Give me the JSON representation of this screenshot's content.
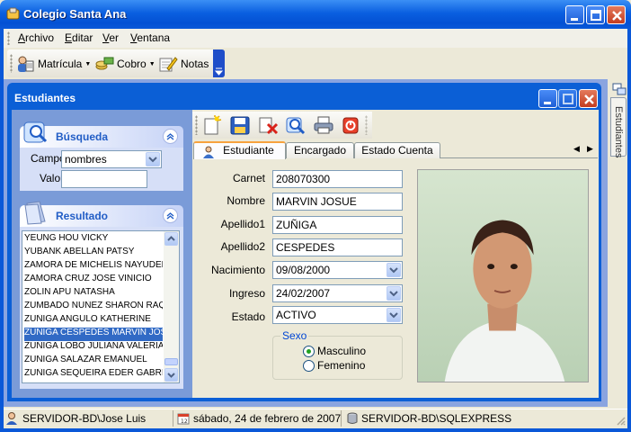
{
  "window": {
    "title": "Colegio Santa Ana"
  },
  "menubar": [
    "Archivo",
    "Editar",
    "Ver",
    "Ventana"
  ],
  "toolbar": {
    "items": [
      {
        "label": "Matrícula",
        "icon": "enrollment-icon",
        "dropdown": true
      },
      {
        "label": "Cobro",
        "icon": "coins-icon",
        "dropdown": true
      },
      {
        "label": "Notas",
        "icon": "pencil-notes-icon",
        "dropdown": false
      }
    ]
  },
  "child": {
    "title": "Estudiantes"
  },
  "search_panel": {
    "title": "Búsqueda",
    "campo_label": "Campo",
    "campo_value": "nombres",
    "valor_label": "Valor",
    "valor_value": ""
  },
  "result_panel": {
    "title": "Resultado",
    "rows": [
      "YEUNG HOU VICKY",
      "YUBANK ABELLAN PATSY",
      "ZAMORA  DE MICHELIS  NAYUDEL",
      "ZAMORA CRUZ JOSE VINICIO",
      "ZOLIN APU NATASHA",
      "ZUMBADO NUÑEZ SHARON RAQU",
      "ZUÑIGA ANGULO KATHERINE",
      "ZUÑIGA CESPEDES MARVIN JOSU",
      "ZUÑIGA LOBO JULIANA VALERIA",
      "ZUÑIGA SALAZAR EMANUEL",
      "ZUÑIGA SEQUEIRA EDER GABRIEL"
    ],
    "selected_index": 7
  },
  "child_toolbar_icons": [
    "new-icon",
    "save-icon",
    "delete-icon",
    "search-icon",
    "print-icon",
    "close-record-icon"
  ],
  "tabs": [
    "Estudiante",
    "Encargado",
    "Estado Cuenta"
  ],
  "active_tab": 0,
  "form": {
    "carnet_label": "Carnet",
    "carnet": "208070300",
    "nombre_label": "Nombre",
    "nombre": "MARVIN JOSUE",
    "apellido1_label": "Apellido1",
    "apellido1": "ZUÑIGA",
    "apellido2_label": "Apellido2",
    "apellido2": "CESPEDES",
    "nacimiento_label": "Nacimiento",
    "nacimiento": "09/08/2000",
    "ingreso_label": "Ingreso",
    "ingreso": "24/02/2007",
    "estado_label": "Estado",
    "estado": "ACTIVO",
    "sexo_label": "Sexo",
    "sexo_options": [
      "Masculino",
      "Femenino"
    ],
    "sexo_selected": "Masculino"
  },
  "side_dock": {
    "label": "Estudiantes"
  },
  "statusbar": {
    "user": "SERVIDOR-BD\\Jose Luis",
    "date": "sábado, 24 de febrero de 2007",
    "server": "SERVIDOR-BD\\SQLEXPRESS"
  },
  "colors": {
    "title_blue": "#0a58d8",
    "selection": "#316ac5",
    "panel_title": "#215dc6",
    "groupbox_label": "#0046d5"
  }
}
